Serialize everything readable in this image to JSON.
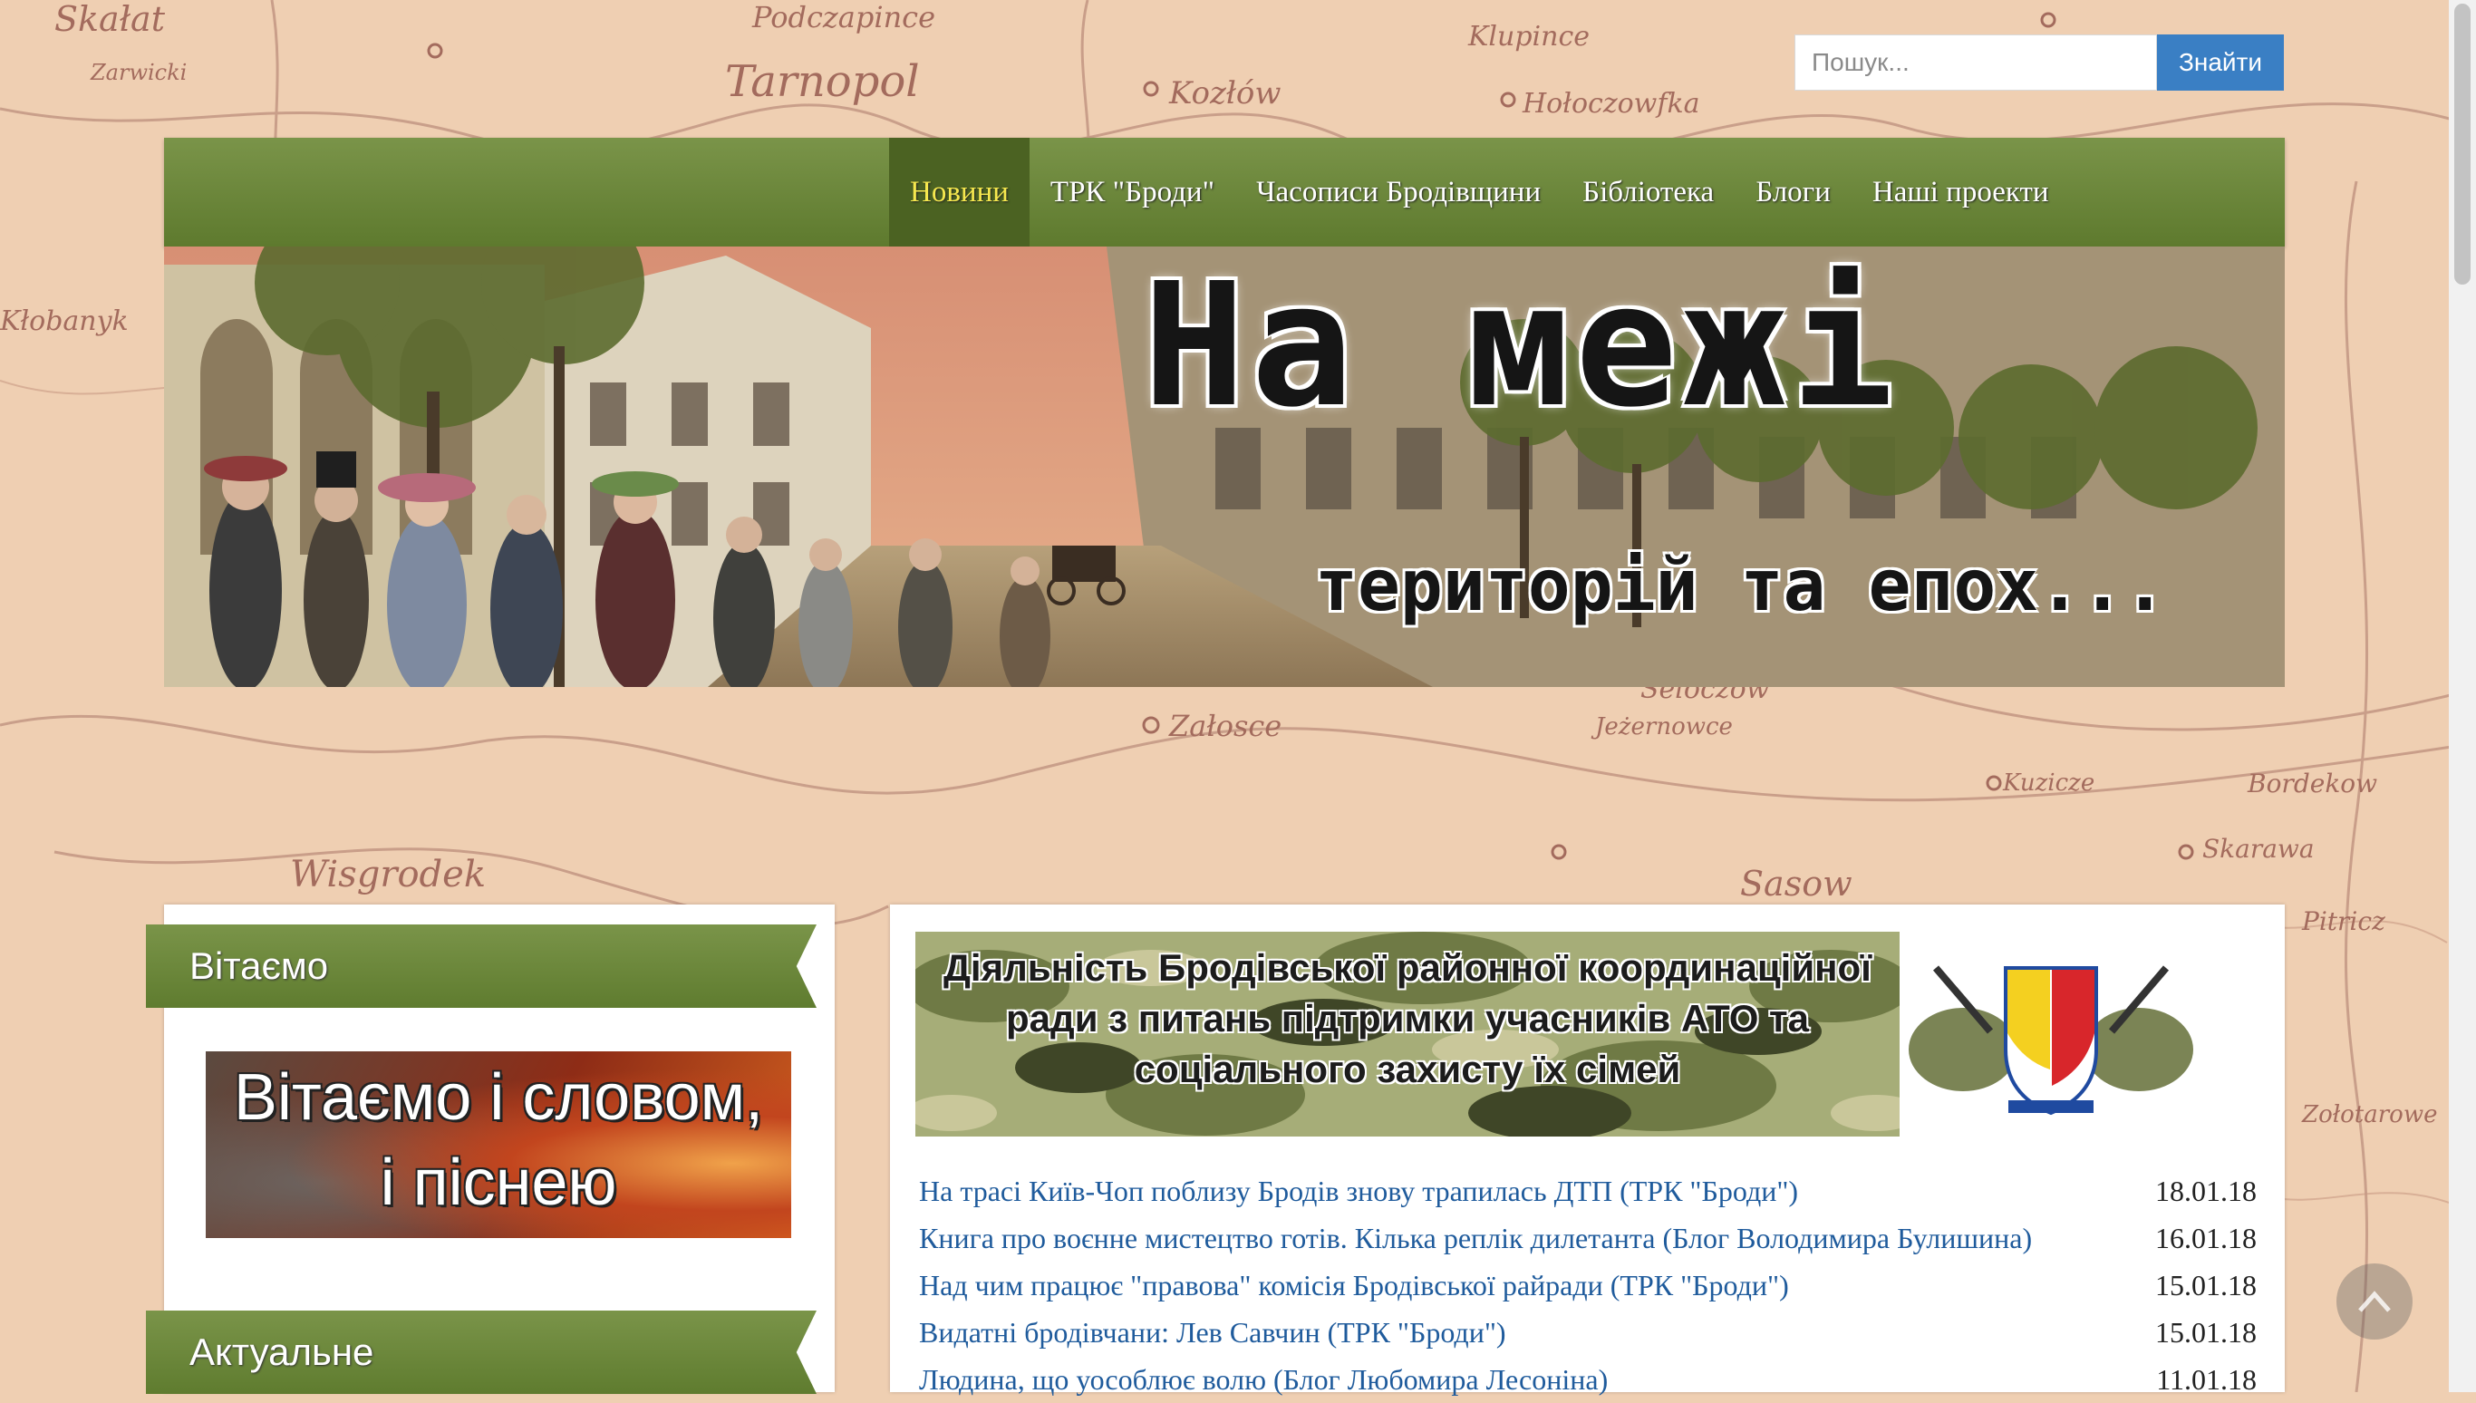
{
  "search": {
    "placeholder": "Пошук...",
    "button": "Знайти"
  },
  "nav": {
    "items": [
      {
        "label": "Новини",
        "active": true
      },
      {
        "label": "ТРК \"Броди\"",
        "active": false
      },
      {
        "label": "Часописи Бродівщини",
        "active": false
      },
      {
        "label": "Бібліотека",
        "active": false
      },
      {
        "label": "Блоги",
        "active": false
      },
      {
        "label": "Наші проекти",
        "active": false
      }
    ]
  },
  "banner": {
    "title": "На межі",
    "subtitle": "територій та епох..."
  },
  "map_labels": [
    "Skałat",
    "Tarnopol",
    "Podczapince",
    "Kozłów",
    "Klupince",
    "Hołoczowfka",
    "Zarwicki",
    "Wisgrodek",
    "Załosce",
    "Sasow",
    "Jeżernowce",
    "Kuzicze",
    "Bordekow",
    "Skarawa",
    "Pitricz",
    "Zołotarowe",
    "Seloczow",
    "Kłobanyk"
  ],
  "sidebar": {
    "welcome_title": "Вітаємо",
    "promo_line1": "Вітаємо і словом,",
    "promo_line2": "і піснею",
    "current_title": "Актуальне"
  },
  "main": {
    "ato_banner": {
      "line1": "Діяльність Бродівської районної координаційної",
      "line2": "ради з питань підтримки учасників АТО та",
      "line3": "соціального захисту їх сімей"
    },
    "news": [
      {
        "title": "На трасі Київ-Чоп поблизу Бродів знову трапилась ДТП (ТРК \"Броди\")",
        "date": "18.01.18"
      },
      {
        "title": "Книга про воєнне мистецтво готів. Кілька реплік дилетанта (Блог Володимира Булишина)",
        "date": "16.01.18"
      },
      {
        "title": "Над чим працює \"правова\" комісія Бродівської райради (ТРК \"Броди\")",
        "date": "15.01.18"
      },
      {
        "title": "Видатні бродівчани: Лев Савчин (ТРК \"Броди\")",
        "date": "15.01.18"
      },
      {
        "title": "Людина, що уособлює волю (Блог Любомира Лесоніна)",
        "date": "11.01.18"
      }
    ]
  },
  "colors": {
    "nav_green": "#6b8a3a",
    "nav_active_text": "#f6e84e",
    "link_blue": "#1f5b9c",
    "search_button": "#3a7fc4",
    "page_bg": "#efcfb2"
  }
}
